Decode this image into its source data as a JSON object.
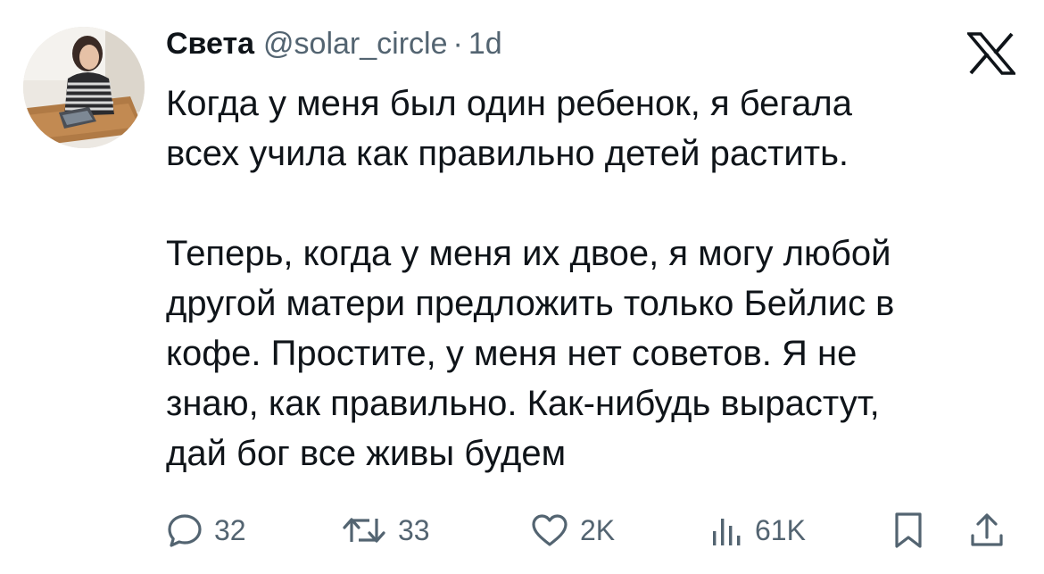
{
  "user": {
    "name": "Света",
    "handle": "@solar_circle",
    "separator": "·",
    "time": "1d"
  },
  "icons": {
    "platform": "x-logo-icon",
    "reply": "reply-icon",
    "retweet": "retweet-icon",
    "like": "heart-icon",
    "views": "views-icon",
    "bookmark": "bookmark-icon",
    "share": "share-icon"
  },
  "text": {
    "paragraph1": "Когда у меня был один ребенок,  я бегала\nвсех учила как правильно детей растить.",
    "paragraph2": "Теперь, когда у меня их двое, я могу любой\nдругой матери предложить только Бейлис в\nкофе. Простите, у меня нет советов. Я не\nзнаю, как правильно. Как-нибудь вырастут,\nдай бог все живы будем"
  },
  "stats": {
    "replies": "32",
    "retweets": "33",
    "likes": "2K",
    "views": "61K"
  },
  "colors": {
    "text": "#0f1419",
    "secondary": "#536471",
    "background": "#ffffff"
  }
}
